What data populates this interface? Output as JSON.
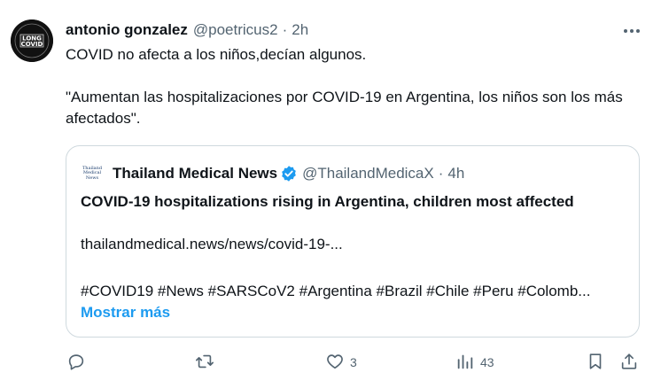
{
  "post": {
    "author": {
      "display_name": "antonio gonzalez",
      "handle": "@poetricus2",
      "avatar_text_top": "LONG",
      "avatar_text_bottom": "COVID"
    },
    "separator": "·",
    "timestamp": "2h",
    "more_icon": "more-horizontal-icon",
    "text_line1": "COVID no afecta a los niños,decían algunos.",
    "text_line2": "\"Aumentan las hospitalizaciones por COVID-19 en Argentina, los niños son los más afectados\"."
  },
  "quoted_post": {
    "display_name": "Thailand Medical News",
    "verified": true,
    "handle": "@ThailandMedicaX",
    "timestamp": "4h",
    "avatar_line1": "Thailand",
    "avatar_line2": "Medical",
    "avatar_line3": "News",
    "title": "COVID-19 hospitalizations rising in Argentina, children most affected",
    "link": "thailandmedical.news/news/covid-19-...",
    "hashtags": "#COVID19 #News #SARSCoV2 #Argentina #Brazil #Chile #Peru #Colomb...",
    "show_more": "Mostrar más"
  },
  "actions": {
    "reply": {
      "icon": "reply-icon",
      "count": ""
    },
    "repost": {
      "icon": "repost-icon",
      "count": ""
    },
    "like": {
      "icon": "heart-icon",
      "count": "3"
    },
    "views": {
      "icon": "views-icon",
      "count": "43"
    },
    "bookmark": {
      "icon": "bookmark-icon"
    },
    "share": {
      "icon": "share-icon"
    }
  },
  "colors": {
    "text_primary": "#0f1419",
    "text_secondary": "#536471",
    "link_blue": "#1d9bf0",
    "border": "#cfd9de"
  }
}
